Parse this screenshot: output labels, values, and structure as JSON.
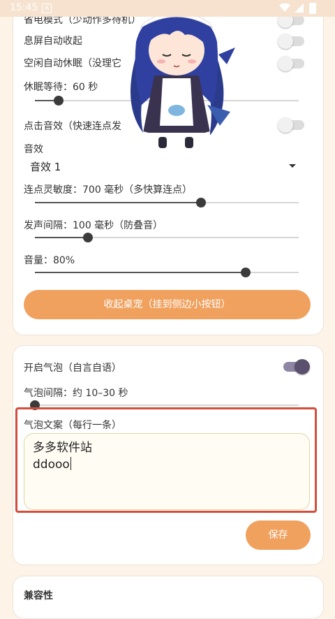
{
  "status_bar": {
    "time": "15:45",
    "badge": "A"
  },
  "settings": {
    "row_cut_text": "省电模式（少动作多待机）",
    "screen_off_label": "息屏自动收起",
    "idle_sleep_label": "空闲自动休眠（没理它",
    "sleep_wait_label": "休眠等待：60 秒",
    "sleep_wait_value": 0.09,
    "click_sound_label": "点击音效（快速连点发",
    "sound_effect_label": "音效",
    "sound_effect_value": "音效 1",
    "sensitivity_label": "连点灵敏度：700 毫秒（多快算连点）",
    "sensitivity_value": 0.63,
    "sound_interval_label": "发声间隔：100 毫秒（防叠音）",
    "sound_interval_value": 0.2,
    "volume_label": "音量：80%",
    "volume_value": 0.8,
    "collapse_button": "收起桌宠（挂到侧边小按钮）"
  },
  "bubble": {
    "enable_label": "开启气泡（自言自语）",
    "enabled": true,
    "interval_label": "气泡间隔：约 10–30 秒",
    "interval_value": 0.0,
    "text_label": "气泡文案（每行一条）",
    "text_lines": [
      "多多软件站",
      "ddooo"
    ],
    "save_button": "保存"
  },
  "next_section": {
    "title": "兼容性"
  },
  "colors": {
    "accent": "#f0a15e",
    "switch_on": "#5b516f",
    "highlight": "#d34d3b"
  },
  "icons": {
    "mascot": "chibi-maid-mascot",
    "dropdown": "caret-down-icon"
  }
}
